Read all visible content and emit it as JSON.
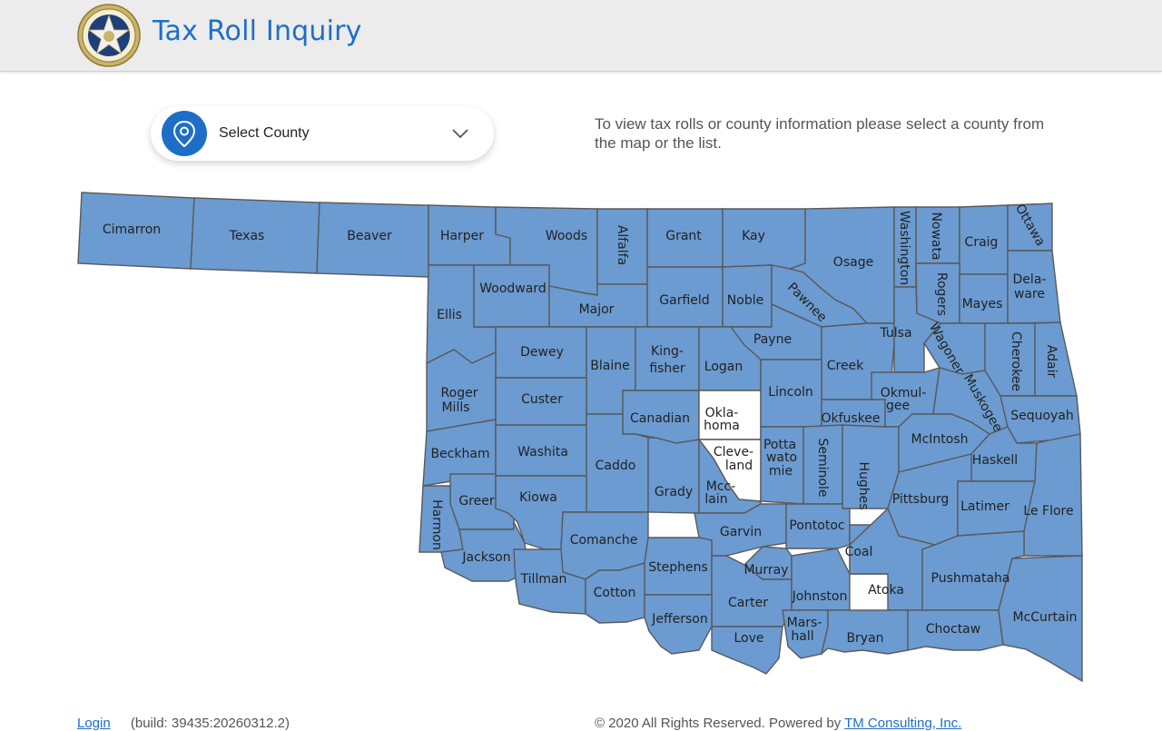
{
  "header": {
    "title": "Tax Roll Inquiry",
    "seal_icon": "oklahoma-state-seal"
  },
  "county_select": {
    "label": "Select County",
    "icon": "map-pin-icon",
    "chevron": "chevron-down-icon"
  },
  "instructions": "To view tax rolls or county information please select a county from the map or the list.",
  "map": {
    "fill_color": "#6b9bd1",
    "highlight_color": "#ffffff",
    "border_color": "#5a5a5a",
    "counties": {
      "cimarron": "Cimarron",
      "texas": "Texas",
      "beaver": "Beaver",
      "harper": "Harper",
      "woods": "Woods",
      "alfalfa": "Alfalfa",
      "grant": "Grant",
      "kay": "Kay",
      "osage": "Osage",
      "washington": "Washington",
      "nowata": "Nowata",
      "craig": "Craig",
      "ottawa": "Ottawa",
      "woodward": "Woodward",
      "ellis": "Ellis",
      "major": "Major",
      "garfield": "Garfield",
      "noble": "Noble",
      "pawnee": "Pawnee",
      "rogers": "Rogers",
      "mayes": "Mayes",
      "delaware_1": "Dela-",
      "delaware_2": "ware",
      "dewey": "Dewey",
      "blaine": "Blaine",
      "kingfisher_1": "King-",
      "kingfisher_2": "fisher",
      "logan": "Logan",
      "payne": "Payne",
      "creek": "Creek",
      "tulsa": "Tulsa",
      "wagoner": "Wagoner",
      "cherokee": "Cherokee",
      "adair": "Adair",
      "roger_mills_1": "Roger",
      "roger_mills_2": "Mills",
      "custer": "Custer",
      "canadian": "Canadian",
      "oklahoma_1": "Okla-",
      "oklahoma_2": "homa",
      "lincoln": "Lincoln",
      "okfuskee": "Okfuskee",
      "okmulgee_1": "Okmul-",
      "okmulgee_2": "gee",
      "muskogee": "Muskogee",
      "sequoyah": "Sequoyah",
      "beckham": "Beckham",
      "washita": "Washita",
      "caddo": "Caddo",
      "cleveland_1": "Cleve-",
      "cleveland_2": "land",
      "pottawatomie_1": "Potta",
      "pottawatomie_2": "wato",
      "pottawatomie_3": "mie",
      "seminole": "Seminole",
      "hughes": "Hughes",
      "mcintosh": "McIntosh",
      "haskell": "Haskell",
      "greer": "Greer",
      "kiowa": "Kiowa",
      "grady": "Grady",
      "mcclain_1": "Mcc-",
      "mcclain_2": "lain",
      "pittsburg": "Pittsburg",
      "latimer": "Latimer",
      "le_flore": "Le Flore",
      "harmon": "Harmon",
      "jackson": "Jackson",
      "comanche": "Comanche",
      "garvin": "Garvin",
      "pontotoc": "Pontotoc",
      "coal": "Coal",
      "tillman": "Tillman",
      "stephens": "Stephens",
      "murray": "Murray",
      "cotton": "Cotton",
      "carter": "Carter",
      "johnston": "Johnston",
      "atoka": "Atoka",
      "pushmataha": "Pushmataha",
      "jefferson": "Jefferson",
      "love": "Love",
      "marshall_1": "Mars-",
      "marshall_2": "hall",
      "bryan": "Bryan",
      "choctaw": "Choctaw",
      "mccurtain": "McCurtain"
    }
  },
  "footer": {
    "login": "Login",
    "build": "(build: 39435:20260312.2)",
    "copyright": "© 2020 All Rights Reserved. Powered by",
    "company": "TM Consulting, Inc."
  }
}
